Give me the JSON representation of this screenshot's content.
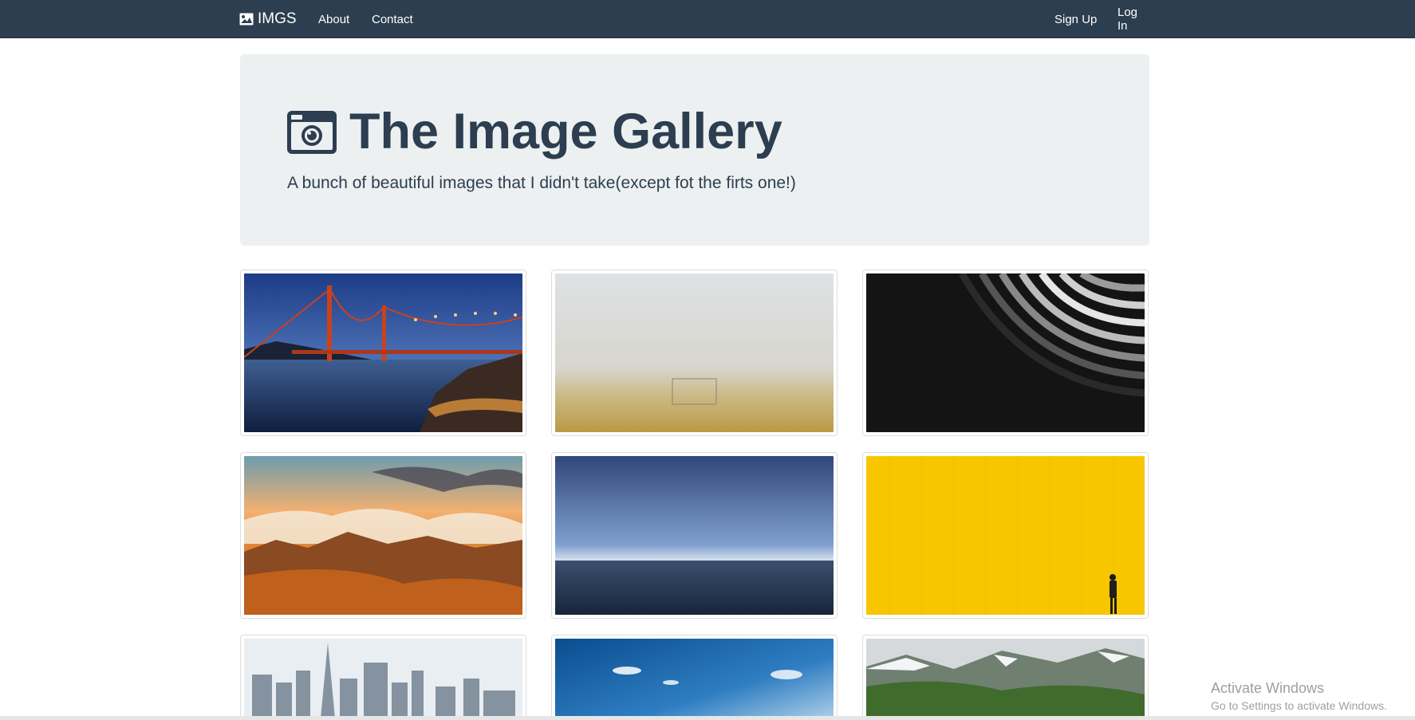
{
  "navbar": {
    "brand": "IMGS",
    "links": [
      "About",
      "Contact"
    ],
    "right_links": [
      "Sign Up",
      "Log In"
    ],
    "brand_icon": "image-icon"
  },
  "jumbotron": {
    "icon": "camera-icon",
    "title": "The Image Gallery",
    "subtitle": "A bunch of beautiful images that I didn't take(except fot the firts one!)"
  },
  "gallery": {
    "thumbnails": [
      "bridge-at-dusk",
      "foggy-field-goal",
      "abstract-architecture",
      "mountains-clouds-sunset",
      "ocean-horizon",
      "yellow-wall-person",
      "city-skyline",
      "blue-sky",
      "green-mountains"
    ]
  },
  "watermark": {
    "line1": "Activate Windows",
    "line2": "Go to Settings to activate Windows."
  },
  "colors": {
    "navbar": "#2c3e50",
    "jumbotron_bg": "#ecf0f1",
    "text": "#2c3e50"
  }
}
